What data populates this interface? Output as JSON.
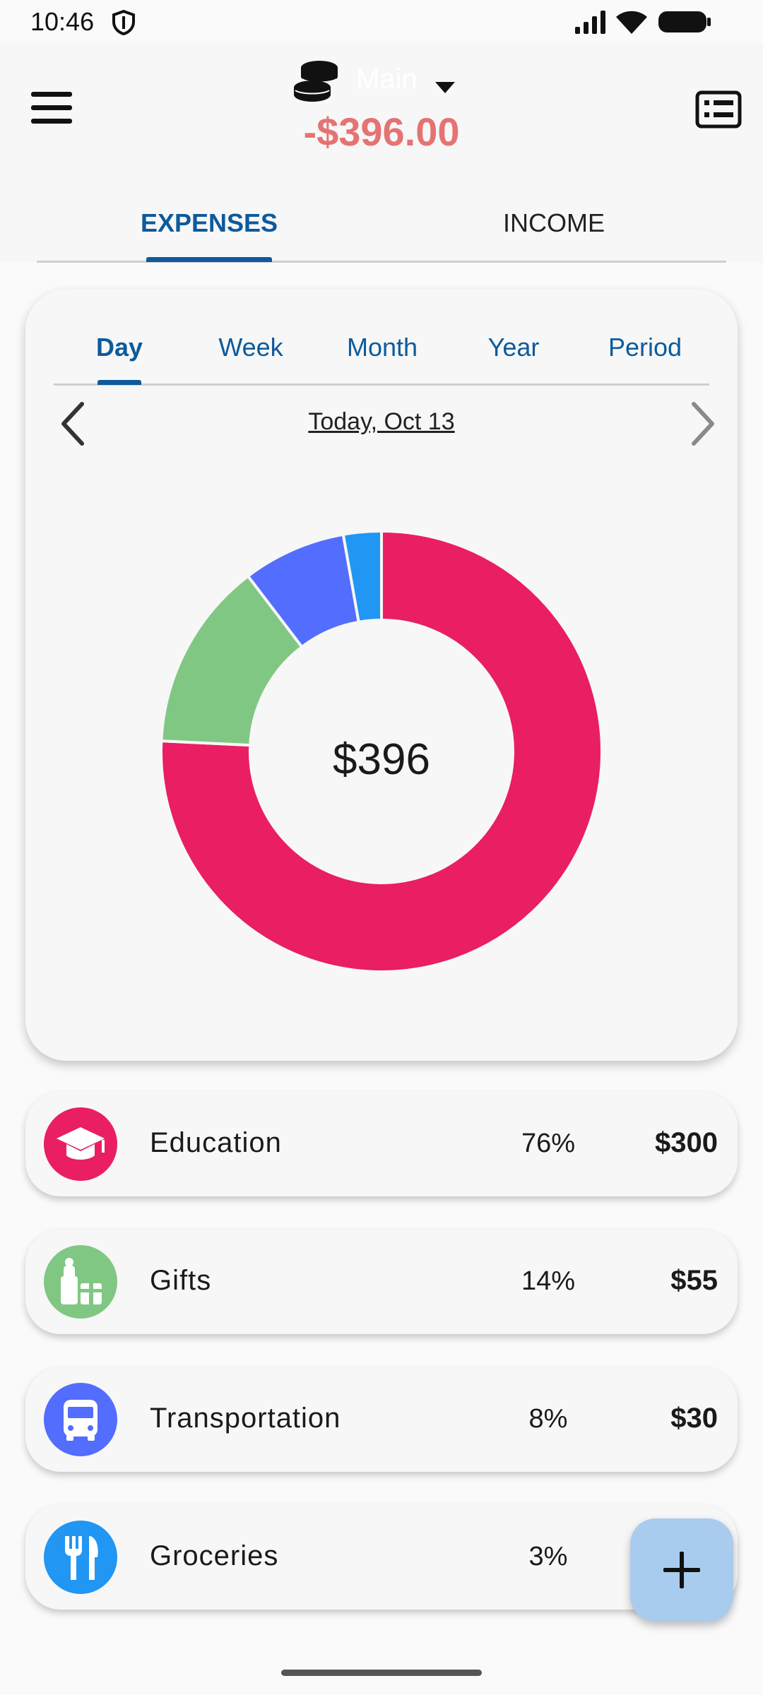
{
  "status_bar": {
    "time": "10:46",
    "icons": [
      "shield-icon",
      "signal-icon",
      "wifi-icon",
      "battery-icon"
    ]
  },
  "header": {
    "account_name": "Main",
    "balance": "-$396.00",
    "balance_color": "#e57373",
    "icons": [
      "menu-icon",
      "coins-icon",
      "caret-down-icon",
      "report-list-icon"
    ]
  },
  "main_tabs": {
    "expenses": "EXPENSES",
    "income": "INCOME",
    "active": "EXPENSES",
    "accent_color": "#0d5a9c"
  },
  "period_tabs": {
    "items": [
      "Day",
      "Week",
      "Month",
      "Year",
      "Period"
    ],
    "active": "Day"
  },
  "date_nav": {
    "label": "Today, Oct 13"
  },
  "chart_data": {
    "type": "pie",
    "donut": true,
    "center_label": "$396",
    "slices": [
      {
        "name": "Education",
        "value": 300,
        "percent": 76,
        "color": "#e91e63"
      },
      {
        "name": "Gifts",
        "value": 55,
        "percent": 14,
        "color": "#81c784"
      },
      {
        "name": "Transportation",
        "value": 30,
        "percent": 8,
        "color": "#536dfe"
      },
      {
        "name": "Groceries",
        "value": 11,
        "percent": 3,
        "color": "#2196f3"
      }
    ]
  },
  "categories": [
    {
      "name": "Education",
      "percent": "76%",
      "amount": "$300",
      "icon": "graduation-cap-icon",
      "color": "#e91e63"
    },
    {
      "name": "Gifts",
      "percent": "14%",
      "amount": "$55",
      "icon": "gift-icon",
      "color": "#81c784"
    },
    {
      "name": "Transportation",
      "percent": "8%",
      "amount": "$30",
      "icon": "bus-icon",
      "color": "#536dfe"
    },
    {
      "name": "Groceries",
      "percent": "3%",
      "amount": "",
      "icon": "fork-knife-icon",
      "color": "#2196f3"
    }
  ],
  "fab": {
    "icon": "plus-icon",
    "color": "#a9ccee"
  }
}
